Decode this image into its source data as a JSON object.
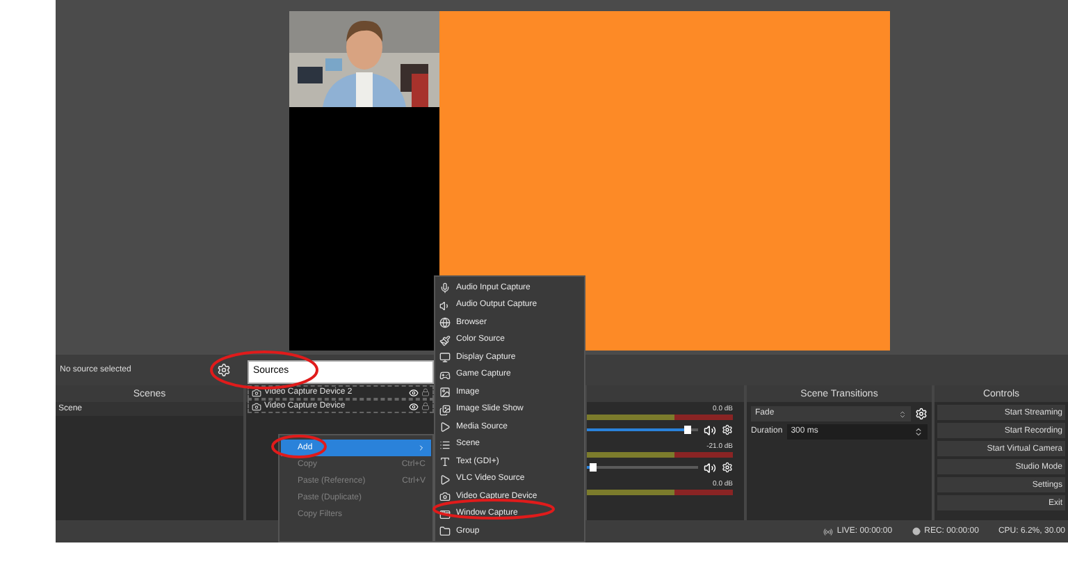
{
  "toolbar": {
    "status": "No source selected"
  },
  "sources_rename": {
    "value": "Sources"
  },
  "sources": [
    {
      "name": "Video Capture Device 2",
      "visible": true
    },
    {
      "name": "Video Capture Device",
      "visible": true
    }
  ],
  "docks": {
    "scenes": {
      "title": "Scenes",
      "items": [
        {
          "name": "Scene",
          "selected": false
        }
      ]
    },
    "transitions": {
      "title": "Scene Transitions",
      "transition": "Fade",
      "duration_label": "Duration",
      "duration": "300 ms"
    },
    "controls": {
      "title": "Controls",
      "buttons": [
        "Start Streaming",
        "Start Recording",
        "Start Virtual Camera",
        "Studio Mode",
        "Settings",
        "Exit"
      ]
    }
  },
  "mixer": [
    {
      "reading": "0.0 dB",
      "level": 0.9
    },
    {
      "reading": "-21.0 dB",
      "level": 0.05
    },
    {
      "reading": "0.0 dB"
    }
  ],
  "context_menu": [
    {
      "label": "Add",
      "selected": true,
      "disabled": false,
      "submenu": true
    },
    {
      "label": "Copy",
      "shortcut": "Ctrl+C",
      "selected": false,
      "disabled": true
    },
    {
      "label": "Paste (Reference)",
      "shortcut": "Ctrl+V",
      "selected": false,
      "disabled": true
    },
    {
      "label": "Paste (Duplicate)",
      "selected": false,
      "disabled": true
    },
    {
      "label": "Copy Filters",
      "selected": false,
      "disabled": true
    }
  ],
  "add_submenu": [
    {
      "label": "Audio Input Capture",
      "selected": false
    },
    {
      "label": "Audio Output Capture",
      "selected": false
    },
    {
      "label": "Browser",
      "selected": false
    },
    {
      "label": "Color Source",
      "selected": false
    },
    {
      "label": "Display Capture",
      "selected": false
    },
    {
      "label": "Game Capture",
      "selected": false
    },
    {
      "label": "Image",
      "selected": false
    },
    {
      "label": "Image Slide Show",
      "selected": false
    },
    {
      "label": "Media Source",
      "selected": false
    },
    {
      "label": "Scene",
      "selected": false
    },
    {
      "label": "Text (GDI+)",
      "selected": false
    },
    {
      "label": "VLC Video Source",
      "selected": false
    },
    {
      "label": "Video Capture Device",
      "selected": false
    },
    {
      "label": "Window Capture",
      "selected": false
    },
    {
      "label": "Group",
      "selected": false
    }
  ],
  "status_bar": {
    "live": "LIVE: 00:00:00",
    "rec": "REC: 00:00:00",
    "cpu": "CPU: 6.2%, 30.00"
  }
}
